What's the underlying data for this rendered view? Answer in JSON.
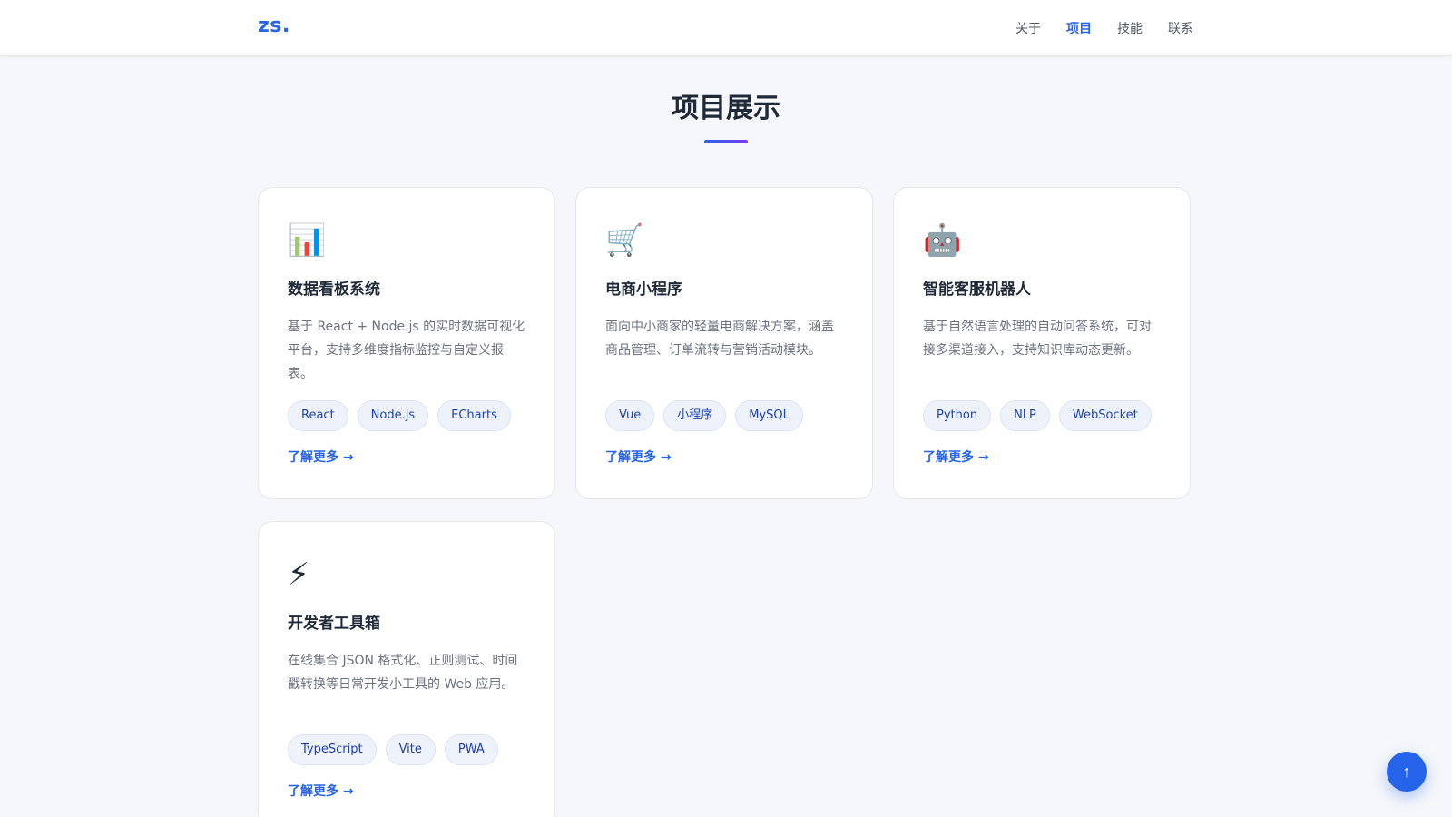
{
  "nav": {
    "logo": "zs.",
    "links": [
      {
        "label": "关于",
        "active": false
      },
      {
        "label": "项目",
        "active": true
      },
      {
        "label": "技能",
        "active": false
      },
      {
        "label": "联系",
        "active": false
      }
    ]
  },
  "section": {
    "title": "项目展示"
  },
  "colors": {
    "accent": "#2563eb",
    "accent_gradient_end": "#7c3aed",
    "tag_bg": "#eef2fb",
    "page_bg": "#f6f7fa"
  },
  "projects": [
    {
      "icon": "📊",
      "icon_name": "bar-chart-icon",
      "title": "数据看板系统",
      "description": "基于 React + Node.js 的实时数据可视化平台，支持多维度指标监控与自定义报表。",
      "tags": [
        "React",
        "Node.js",
        "ECharts"
      ],
      "link": "了解更多 →"
    },
    {
      "icon": "🛒",
      "icon_name": "shopping-cart-icon",
      "title": "电商小程序",
      "description": "面向中小商家的轻量电商解决方案，涵盖商品管理、订单流转与营销活动模块。",
      "tags": [
        "Vue",
        "小程序",
        "MySQL"
      ],
      "link": "了解更多 →"
    },
    {
      "icon": "🤖",
      "icon_name": "robot-icon",
      "title": "智能客服机器人",
      "description": "基于自然语言处理的自动问答系统，可对接多渠道接入，支持知识库动态更新。",
      "tags": [
        "Python",
        "NLP",
        "WebSocket"
      ],
      "link": "了解更多 →"
    },
    {
      "icon": "⚡",
      "icon_name": "lightning-icon",
      "title": "开发者工具箱",
      "description": "在线集合 JSON 格式化、正则测试、时间戳转换等日常开发小工具的 Web 应用。",
      "tags": [
        "TypeScript",
        "Vite",
        "PWA"
      ],
      "link": "了解更多 →"
    }
  ],
  "back_to_top": "↑"
}
